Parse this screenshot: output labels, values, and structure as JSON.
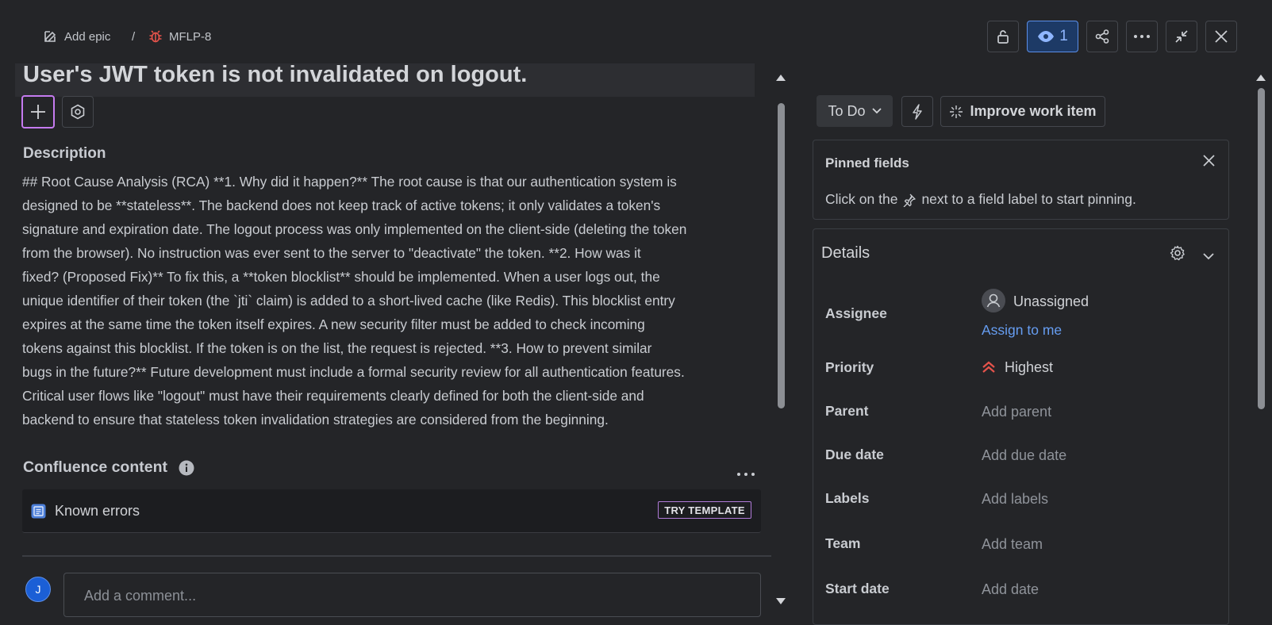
{
  "breadcrumb": {
    "epic_label": "Add epic",
    "separator": "/",
    "issue_key": "MFLP-8"
  },
  "toolbar": {
    "watchers_count": "1"
  },
  "issue": {
    "title": "User's JWT token is not invalidated on logout.",
    "description_heading": "Description",
    "description_lines": [
      "## Root Cause Analysis (RCA) **1. Why did it happen?** The root cause is that our authentication system is",
      "designed to be **stateless**. The backend does not keep track of active tokens; it only validates a token's",
      "signature and expiration date. The logout process was only implemented on the client-side (deleting the token",
      "from the browser). No instruction was ever sent to the server to \"deactivate\" the token. **2. How was it",
      "fixed? (Proposed Fix)** To fix this, a **token blocklist** should be implemented. When a user logs out, the",
      "unique identifier of their token (the `jti` claim) is added to a short-lived cache (like Redis). This blocklist entry",
      "expires at the same time the token itself expires. A new security filter must be added to check incoming",
      "tokens against this blocklist. If the token is on the list, the request is rejected. **3. How to prevent similar",
      "bugs in the future?** Future development must include a formal security review for all authentication features.",
      "Critical user flows like \"logout\" must have their requirements clearly defined for both the client-side and",
      "backend to ensure that stateless token invalidation strategies are considered from the beginning."
    ]
  },
  "confluence": {
    "heading": "Confluence content",
    "item": "Known errors",
    "try_template": "TRY TEMPLATE"
  },
  "comment": {
    "avatar_initial": "J",
    "placeholder": "Add a comment..."
  },
  "side": {
    "status": "To Do",
    "improve": "Improve work item",
    "pinned_heading": "Pinned fields",
    "pinned_text_before": "Click on the",
    "pinned_text_after": "next to a field label to start pinning.",
    "details_heading": "Details",
    "fields": {
      "assignee_label": "Assignee",
      "assignee_value": "Unassigned",
      "assign_to_me": "Assign to me",
      "priority_label": "Priority",
      "priority_value": "Highest",
      "parent_label": "Parent",
      "parent_value": "Add parent",
      "due_label": "Due date",
      "due_value": "Add due date",
      "labels_label": "Labels",
      "labels_value": "Add labels",
      "team_label": "Team",
      "team_value": "Add team",
      "start_label": "Start date",
      "start_value": "Add date"
    }
  },
  "colors": {
    "accent_blue": "#5b8fe8",
    "priority_red": "#e5534b",
    "focus_purple": "#c57bf0"
  }
}
